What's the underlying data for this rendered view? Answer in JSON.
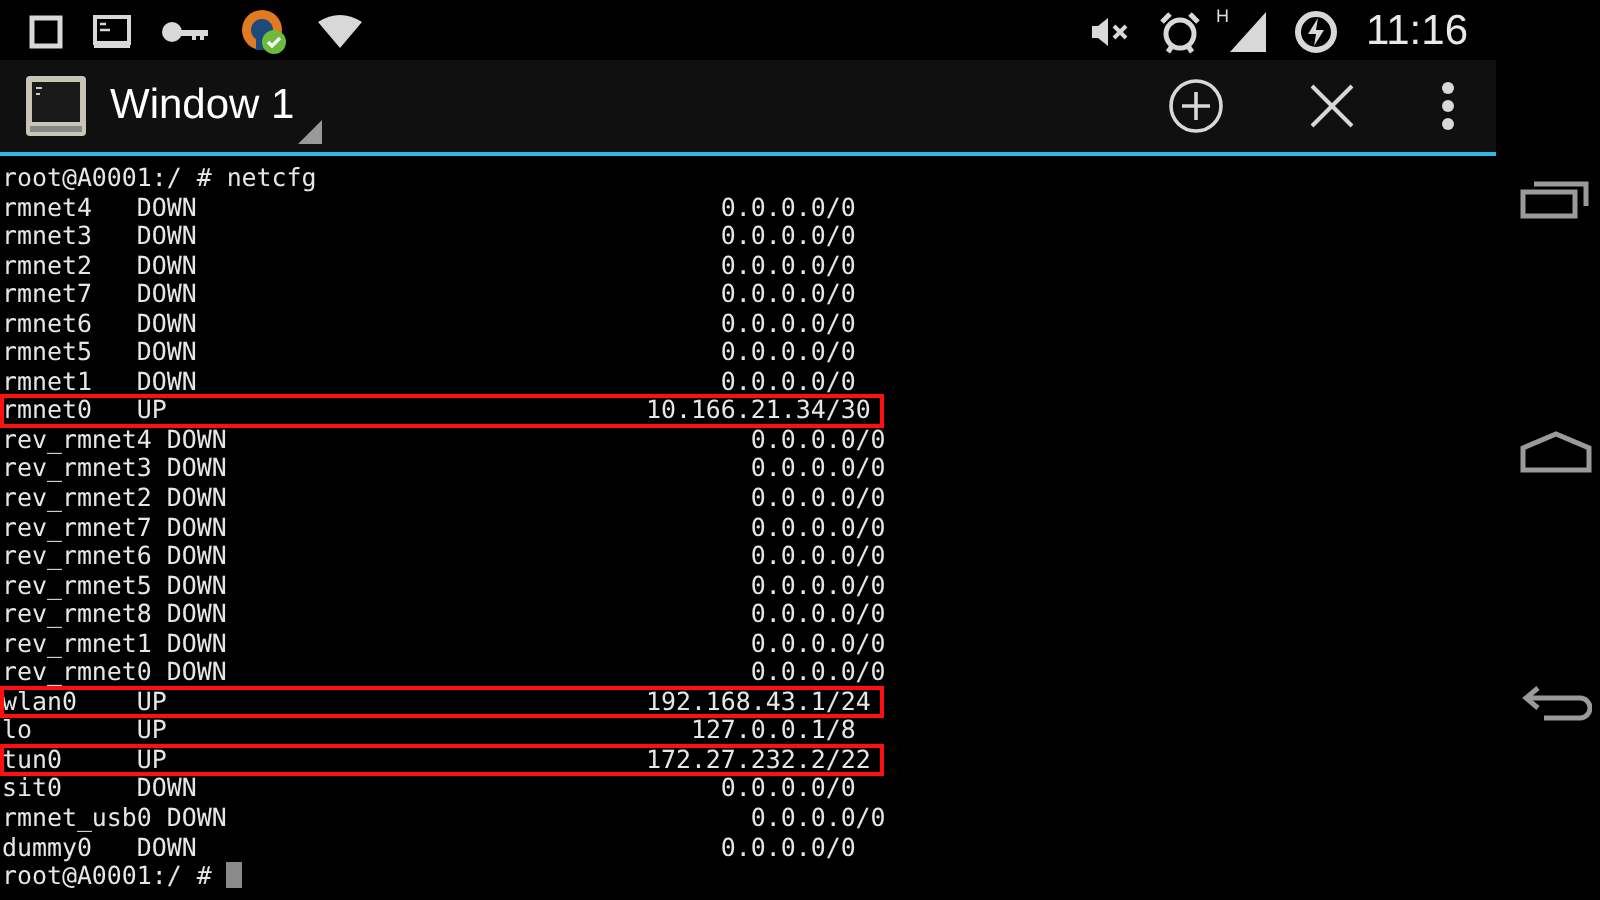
{
  "status_bar": {
    "network_type": "H",
    "time": "11:16"
  },
  "action_bar": {
    "title": "Window 1"
  },
  "terminal": {
    "command_line": "root@A0001:/ # netcfg",
    "rows": [
      {
        "name": "rmnet4",
        "state": "DOWN",
        "address": "0.0.0.0/0",
        "highlighted": false
      },
      {
        "name": "rmnet3",
        "state": "DOWN",
        "address": "0.0.0.0/0",
        "highlighted": false
      },
      {
        "name": "rmnet2",
        "state": "DOWN",
        "address": "0.0.0.0/0",
        "highlighted": false
      },
      {
        "name": "rmnet7",
        "state": "DOWN",
        "address": "0.0.0.0/0",
        "highlighted": false
      },
      {
        "name": "rmnet6",
        "state": "DOWN",
        "address": "0.0.0.0/0",
        "highlighted": false
      },
      {
        "name": "rmnet5",
        "state": "DOWN",
        "address": "0.0.0.0/0",
        "highlighted": false
      },
      {
        "name": "rmnet1",
        "state": "DOWN",
        "address": "0.0.0.0/0",
        "highlighted": false
      },
      {
        "name": "rmnet0",
        "state": "UP",
        "address": "10.166.21.34/30",
        "highlighted": true
      },
      {
        "name": "rev_rmnet4",
        "state": "DOWN",
        "address": "0.0.0.0/0",
        "highlighted": false
      },
      {
        "name": "rev_rmnet3",
        "state": "DOWN",
        "address": "0.0.0.0/0",
        "highlighted": false
      },
      {
        "name": "rev_rmnet2",
        "state": "DOWN",
        "address": "0.0.0.0/0",
        "highlighted": false
      },
      {
        "name": "rev_rmnet7",
        "state": "DOWN",
        "address": "0.0.0.0/0",
        "highlighted": false
      },
      {
        "name": "rev_rmnet6",
        "state": "DOWN",
        "address": "0.0.0.0/0",
        "highlighted": false
      },
      {
        "name": "rev_rmnet5",
        "state": "DOWN",
        "address": "0.0.0.0/0",
        "highlighted": false
      },
      {
        "name": "rev_rmnet8",
        "state": "DOWN",
        "address": "0.0.0.0/0",
        "highlighted": false
      },
      {
        "name": "rev_rmnet1",
        "state": "DOWN",
        "address": "0.0.0.0/0",
        "highlighted": false
      },
      {
        "name": "rev_rmnet0",
        "state": "DOWN",
        "address": "0.0.0.0/0",
        "highlighted": false
      },
      {
        "name": "wlan0",
        "state": "UP",
        "address": "192.168.43.1/24",
        "highlighted": true
      },
      {
        "name": "lo",
        "state": "UP",
        "address": "127.0.0.1/8",
        "highlighted": false
      },
      {
        "name": "tun0",
        "state": "UP",
        "address": "172.27.232.2/22",
        "highlighted": true
      },
      {
        "name": "sit0",
        "state": "DOWN",
        "address": "0.0.0.0/0",
        "highlighted": false
      },
      {
        "name": "rmnet_usb0",
        "state": "DOWN",
        "address": "0.0.0.0/0",
        "highlighted": false
      },
      {
        "name": "dummy0",
        "state": "DOWN",
        "address": "0.0.0.0/0",
        "highlighted": false
      }
    ],
    "prompt": "root@A0001:/ #"
  }
}
